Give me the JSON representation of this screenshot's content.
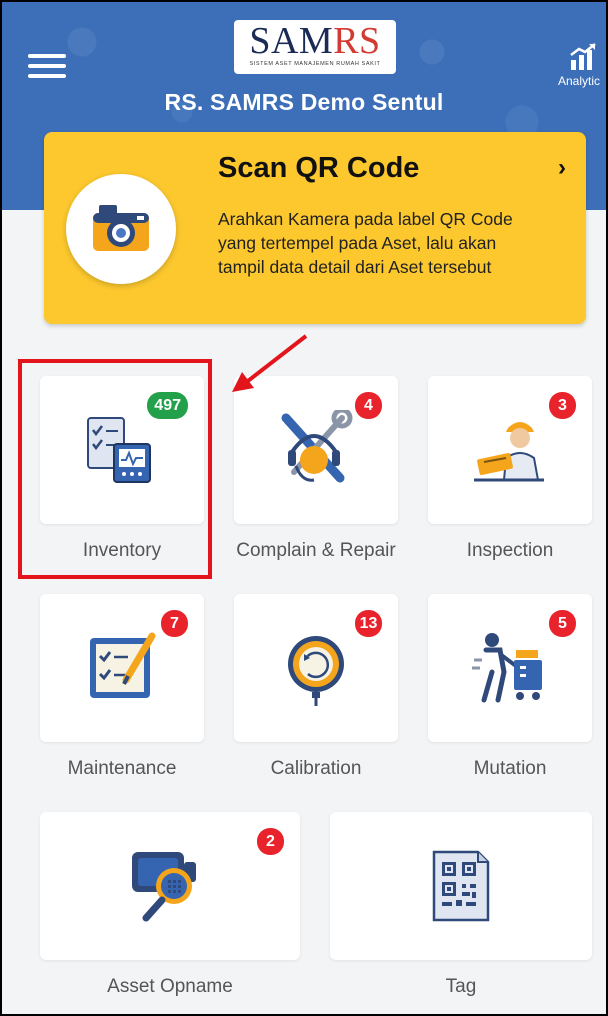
{
  "header": {
    "logo": {
      "text_main": "SAM",
      "text_accent": "RS",
      "subtitle": "SISTEM ASET MANAJEMEN RUMAH SAKIT"
    },
    "hospital_name": "RS. SAMRS Demo Sentul",
    "analytics_label": "Analytic",
    "background_color": "#3c6fb8"
  },
  "scan_card": {
    "title": "Scan QR Code",
    "description": "Arahkan Kamera pada label QR Code yang tertempel pada Aset, lalu akan tampil data detail dari Aset tersebut",
    "chevron": "›",
    "icon": "camera-icon",
    "background_color": "#fcc82e"
  },
  "menu": {
    "inventory": {
      "label": "Inventory",
      "badge": "497",
      "icon": "inventory-checklist-icon"
    },
    "complain": {
      "label": "Complain & Repair",
      "badge": "4",
      "icon": "tools-headset-icon"
    },
    "inspection": {
      "label": "Inspection",
      "badge": "3",
      "icon": "inspector-person-icon"
    },
    "maintenance": {
      "label": "Maintenance",
      "badge": "7",
      "icon": "maintenance-clipboard-icon"
    },
    "calibration": {
      "label": "Calibration",
      "badge": "13",
      "icon": "calibration-ring-icon"
    },
    "mutation": {
      "label": "Mutation",
      "badge": "5",
      "icon": "mutation-cart-icon"
    },
    "opname": {
      "label": "Asset Opname",
      "badge": "2",
      "icon": "asset-opname-magnifier-icon"
    },
    "tag": {
      "label": "Tag",
      "icon": "qr-tag-icon"
    }
  },
  "colors": {
    "badge_red": "#e8232b",
    "badge_green": "#23a04a",
    "highlight": "#e3141b"
  }
}
